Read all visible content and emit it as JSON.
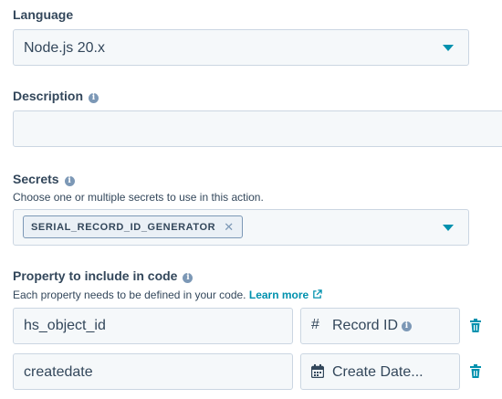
{
  "language": {
    "label": "Language",
    "selected": "Node.js 20.x"
  },
  "description": {
    "label": "Description",
    "value": ""
  },
  "secrets": {
    "label": "Secrets",
    "subtext": "Choose one or multiple secrets to use in this action.",
    "tags": [
      "SERIAL_RECORD_ID_GENERATOR"
    ]
  },
  "properties": {
    "label": "Property to include in code",
    "subtext": "Each property needs to be defined in your code.",
    "learn_more": "Learn more",
    "rows": [
      {
        "name": "hs_object_id",
        "property": "Record ID",
        "property_icon": "hash-icon"
      },
      {
        "name": "createdate",
        "property": "Create Date...",
        "property_icon": "calendar-icon"
      }
    ]
  },
  "colors": {
    "accent": "#0091ae",
    "text": "#33475b",
    "field_bg": "#f5f8fa",
    "border": "#cbd6e2"
  }
}
